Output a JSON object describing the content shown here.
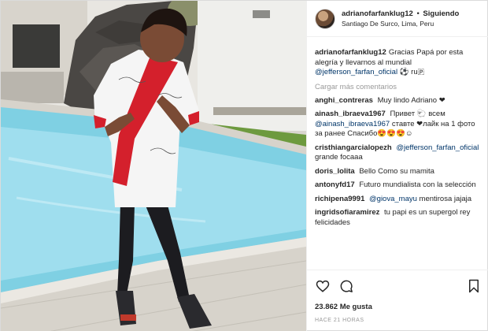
{
  "header": {
    "username": "adrianofarfanklug12",
    "separator": "•",
    "follow_label": "Siguiendo",
    "location": "Santiago De Surco, Lima, Peru"
  },
  "caption": {
    "username": "adrianofarfanklug12",
    "text": "Gracias Papá por esta alegría y llevarnos al mundial",
    "mention": "@jefferson_farfan_oficial",
    "emoji": "⚽ ru🇵"
  },
  "load_more_label": "Cargar más comentarios",
  "comments": [
    {
      "user": "anghi_contreras",
      "text": "Muy lindo Adriano ❤"
    },
    {
      "user": "ainash_ibraeva1967",
      "text": "Привет 🐑 всем",
      "mention": "@ainash_ibraeva1967",
      "text2": "ставте ❤лайк на 1 фото за ранее Спасибо😍😍😍☺"
    },
    {
      "user": "cristhiangarcialopezh",
      "mention": "@jefferson_farfan_oficial",
      "text2": "grande focaaa"
    },
    {
      "user": "doris_lolita",
      "text": "Bello Como su mamita"
    },
    {
      "user": "antonyfd17",
      "text": "Futuro mundialista con la selección"
    },
    {
      "user": "richipena9991",
      "mention": "@giova_mayu",
      "text2": "mentirosa jajaja"
    },
    {
      "user": "ingridsofiaramirez",
      "text": "tu papi es un supergol rey felicidades"
    }
  ],
  "likes": "23.862 Me gusta",
  "time": "HACE 21 HORAS",
  "icons": [
    "heart-icon",
    "comment-icon",
    "bookmark-icon"
  ],
  "colors": {
    "mention": "#003569",
    "muted": "#999999",
    "jersey_red": "#d4202c",
    "pool": "#7fd0e3"
  }
}
